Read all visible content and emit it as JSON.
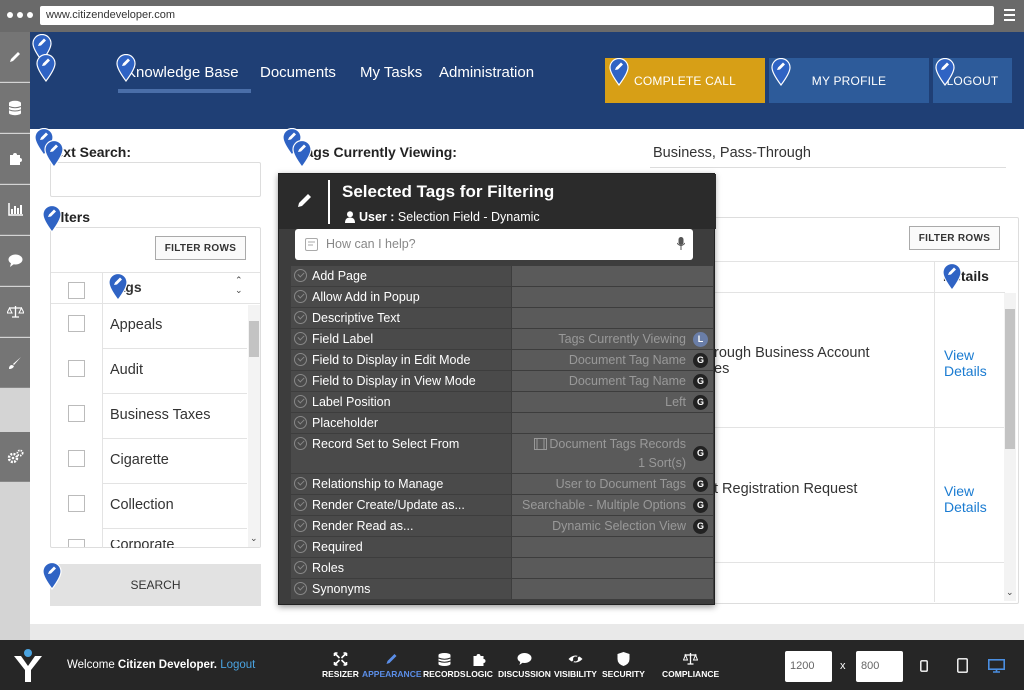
{
  "browser": {
    "url": "www.citizendeveloper.com"
  },
  "nav": {
    "items": [
      "Knowledge Base",
      "Documents",
      "My Tasks",
      "Administration"
    ],
    "complete_call": "COMPLETE CALL",
    "my_profile": "MY PROFILE",
    "logout": "LOGOUT"
  },
  "left": {
    "text_search_label": "Text Search:",
    "filters_label": "Filters",
    "filter_rows_button": "FILTER ROWS",
    "tags_header": "Tags",
    "tags": [
      "Appeals",
      "Audit",
      "Business Taxes",
      "Cigarette",
      "Collection",
      "Corporate"
    ],
    "search_button": "SEARCH"
  },
  "middle": {
    "tags_viewing_label": "Tags Currently Viewing:"
  },
  "right": {
    "viewing_value": "Business, Pass-Through",
    "filter_rows_button": "FILTER ROWS",
    "details_header": "Details",
    "rows": [
      {
        "line1": "rough Business Account",
        "line2": "es",
        "link": "View Details"
      },
      {
        "line1": "t Registration Request",
        "line2": "",
        "link": "View Details"
      }
    ]
  },
  "popup": {
    "title": "Selected Tags for Filtering",
    "subtitle_strong": "User :",
    "subtitle": "Selection Field - Dynamic",
    "search_placeholder": "How can I help?",
    "rows": [
      {
        "name": "Add Page",
        "value": "",
        "badge": ""
      },
      {
        "name": "Allow Add in Popup",
        "value": "",
        "badge": ""
      },
      {
        "name": "Descriptive Text",
        "value": "",
        "badge": ""
      },
      {
        "name": "Field Label",
        "value": "Tags Currently Viewing",
        "badge": "L"
      },
      {
        "name": "Field to Display in Edit Mode",
        "value": "Document Tag Name",
        "badge": "G"
      },
      {
        "name": "Field to Display in View Mode",
        "value": "Document Tag Name",
        "badge": "G"
      },
      {
        "name": "Label Position",
        "value": "Left",
        "badge": "G"
      },
      {
        "name": "Placeholder",
        "value": "",
        "badge": ""
      },
      {
        "name": "Record Set to Select From",
        "value": "Document Tags Records",
        "value2": "1 Sort(s)",
        "badge": "G"
      },
      {
        "name": "Relationship to Manage",
        "value": "User to Document Tags",
        "badge": "G"
      },
      {
        "name": "Render Create/Update as...",
        "value": "Searchable - Multiple Options",
        "badge": "G"
      },
      {
        "name": "Render Read as...",
        "value": "Dynamic Selection View",
        "badge": "G"
      },
      {
        "name": "Required",
        "value": "",
        "badge": ""
      },
      {
        "name": "Roles",
        "value": "",
        "badge": ""
      },
      {
        "name": "Synonyms",
        "value": "",
        "badge": ""
      }
    ]
  },
  "bottom": {
    "welcome": "Welcome",
    "user": "Citizen Developer.",
    "logout": "Logout",
    "tools": [
      "RESIZER",
      "APPEARANCE",
      "RECORDS",
      "LOGIC",
      "DISCUSSION",
      "VISIBILITY",
      "SECURITY",
      "COMPLIANCE"
    ],
    "width": "1200",
    "x": "x",
    "height": "800"
  },
  "colors": {
    "nav_bg": "#1f3f75",
    "complete_call": "#d79f16",
    "nav_button": "#2d5b9a",
    "link": "#1a7bd1",
    "marker": "#2f63c4",
    "appearance_active": "#5b8ee8"
  }
}
